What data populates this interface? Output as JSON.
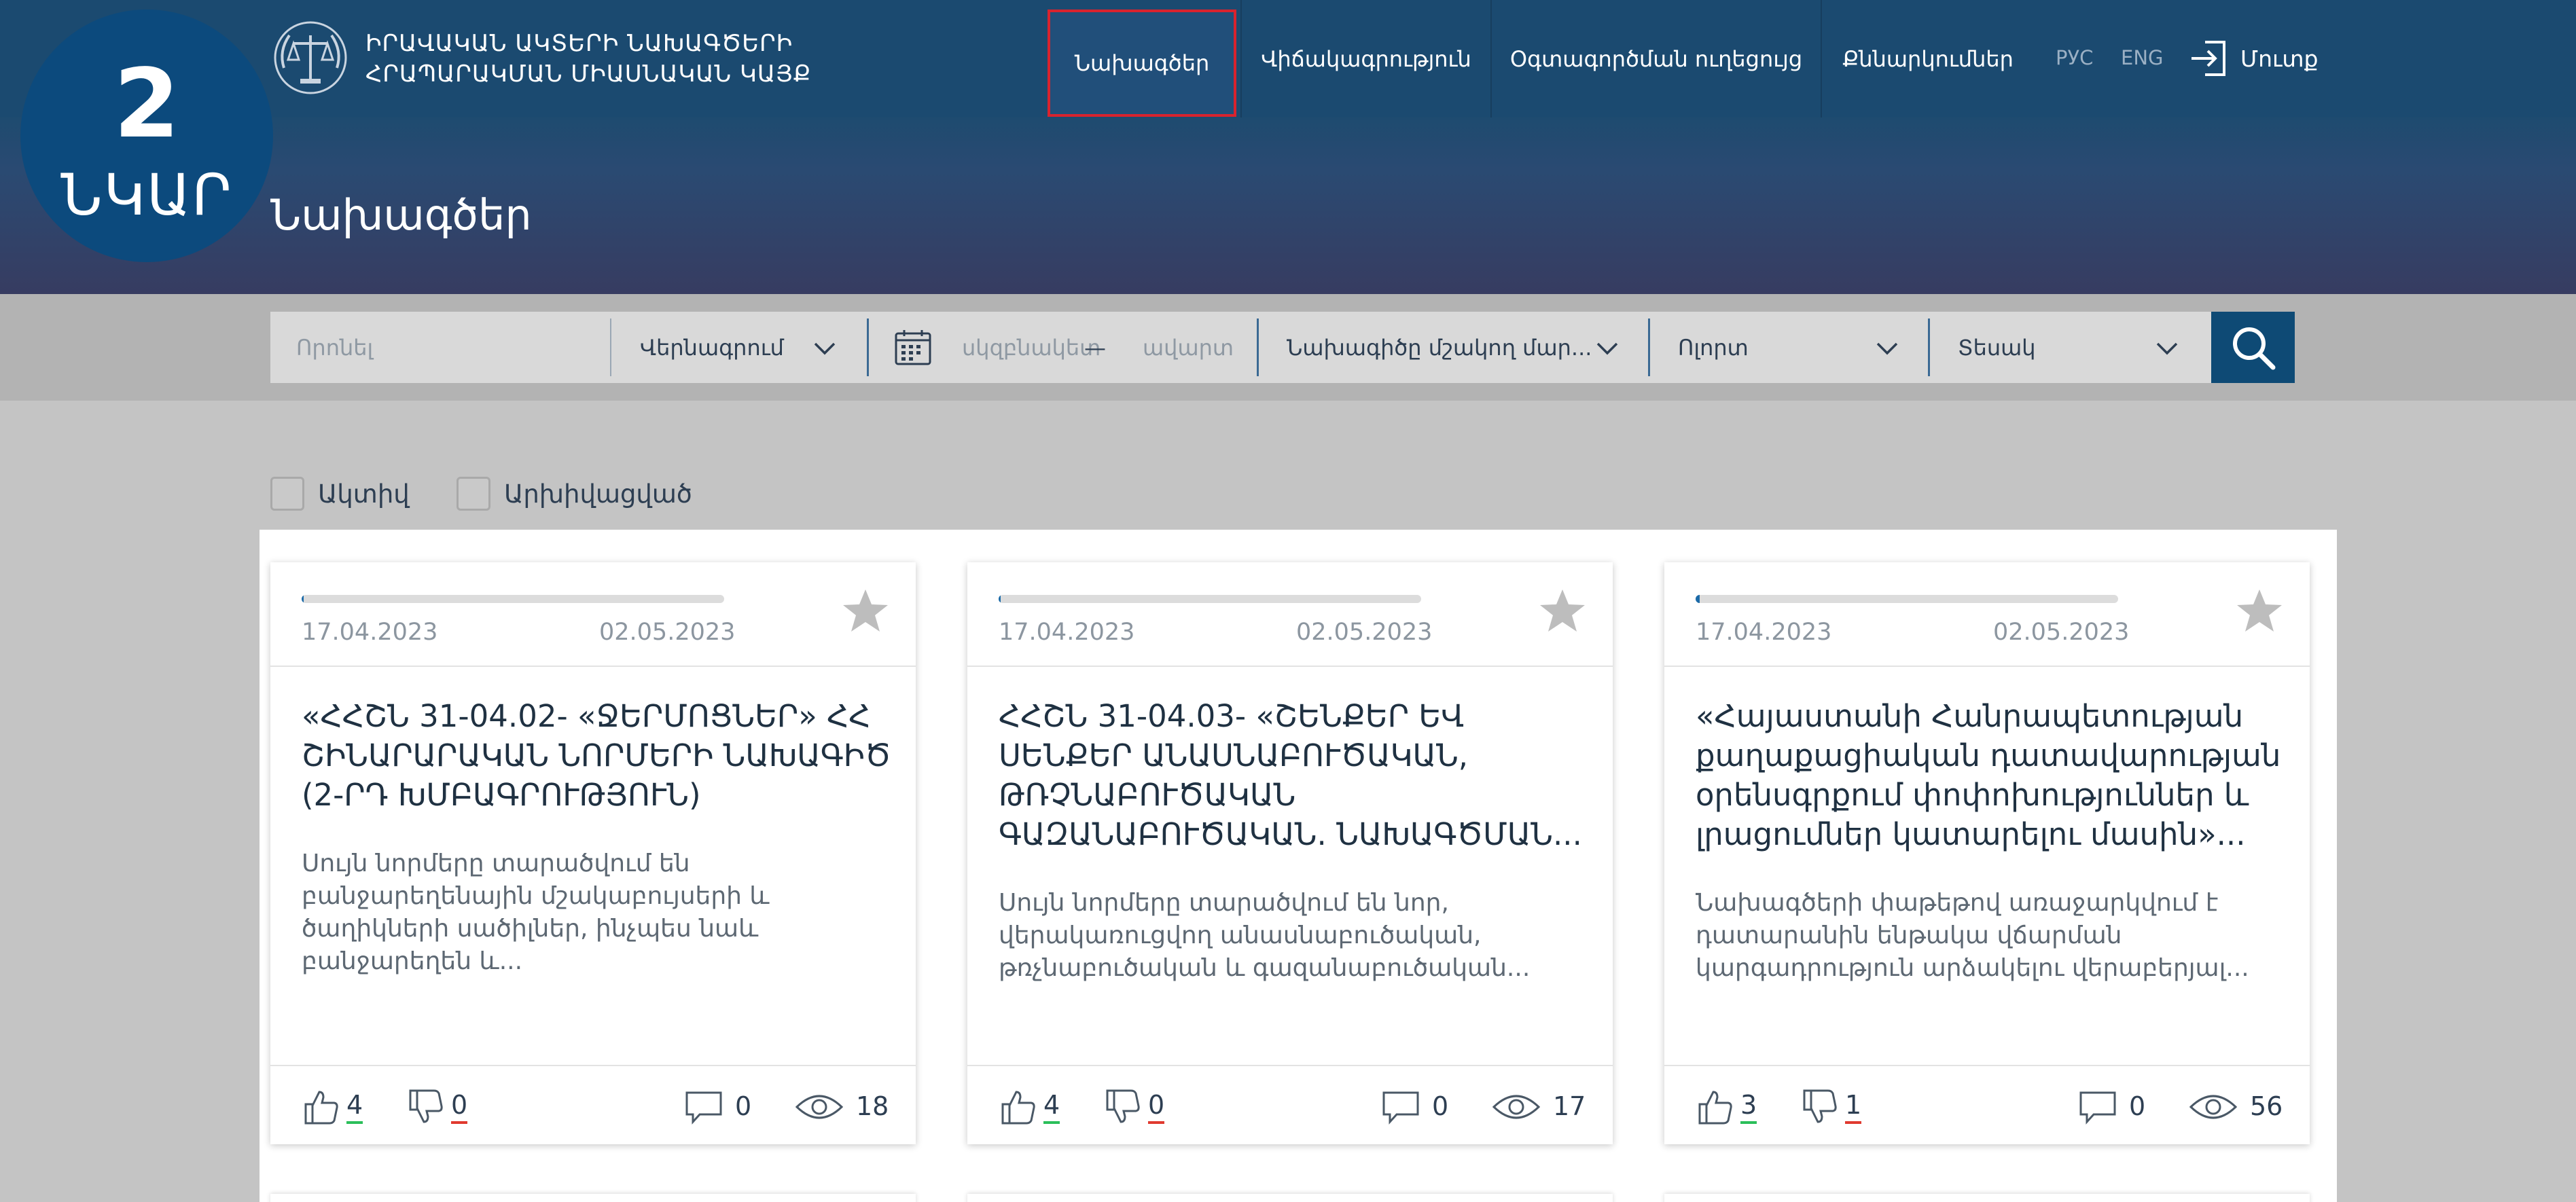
{
  "header": {
    "logo_line1": "ԻՐԱՎԱԿԱՆ ԱԿՏԵՐԻ ՆԱԽԱԳԾԵՐԻ",
    "logo_line2": "ՀՐԱՊԱՐԱԿՄԱՆ ՄԻԱՍՆԱԿԱՆ ԿԱՅՔ",
    "nav": [
      {
        "label": "Նախագծեր",
        "active": true
      },
      {
        "label": "Վիճակագրություն"
      },
      {
        "label": "Օգտագործման ուղեցույց"
      },
      {
        "label": "Քննարկումներ"
      }
    ],
    "lang_ru": "РУС",
    "lang_en": "ENG",
    "login_label": "Մուտք"
  },
  "badge": {
    "number": "2",
    "word": "ՆԿԱՐ"
  },
  "page_title": "Նախագծեր",
  "filters": {
    "search_placeholder": "Որոնել",
    "sort_label": "Վերնագրում",
    "date_from_placeholder": "սկզբնակետ",
    "date_to_placeholder": "ավարտ",
    "date_separator": "—",
    "developer_label": "Նախագիծը մշակող մար...",
    "area_label": "Ոլորտ",
    "type_label": "Տեսակ"
  },
  "checkboxes": {
    "active_label": "Ակտիվ",
    "archived_label": "Արխիվացված"
  },
  "cards": [
    {
      "start": "17.04.2023",
      "end": "02.05.2023",
      "progress": 0.0,
      "title": "«ՀՀՇՆ 31-04.02- «ՋԵՐՄՈՑՆԵՐ» ՀՀ ՇԻՆԱՐԱՐԱԿԱՆ ՆՈՐՄԵՐԻ ՆԱԽԱԳԻԾ (2-ՐԴ ԽՄԲԱԳՐՈՒԹՅՈՒՆ)",
      "description": "Սույն նորմերը տարածվում են բանջարեղենային մշակաբույսերի և ծաղիկների սածիլներ, ինչպես նաև բանջարեղեն և...",
      "likes": "4",
      "dislikes": "0",
      "comments": "0",
      "views": "18"
    },
    {
      "start": "17.04.2023",
      "end": "02.05.2023",
      "progress": 0.0,
      "title": "ՀՀՇՆ 31-04.03- «ՇԵՆՔԵՐ ԵՎ ՍԵՆՔԵՐ ԱՆԱՍՆԱԲՈՒԾԱԿԱՆ, ԹՌՉՆԱԲՈՒԾԱԿԱՆ ԳԱԶԱՆԱԲՈՒԾԱԿԱՆ. ՆԱԽԱԳԾՄԱՆ...",
      "description": "Սույն նորմերը տարածվում են նոր, վերակառուցվող անասնաբուծական, թռչնաբուծական և գազանաբուծական...",
      "likes": "4",
      "dislikes": "0",
      "comments": "0",
      "views": "17"
    },
    {
      "start": "17.04.2023",
      "end": "02.05.2023",
      "progress": 0.01,
      "title": "«Հայաստանի Հանրապետության քաղաքացիական դատավարության օրենսգրքում փոփոխություններ և լրացումներ կատարելու մասին»...",
      "description": "Նախագծերի փաթեթով առաջարկվում է դատարանին ենթակա վճարման կարգադրություն արձակելու վերաբերյալ...",
      "likes": "3",
      "dislikes": "1",
      "comments": "0",
      "views": "56"
    }
  ],
  "colors": {
    "header_bg": "#1b4a70",
    "accent_red": "#d9232e",
    "search_button": "#0e4a75",
    "like_underline": "#2bbf5a",
    "dislike_underline": "#e03a2f"
  },
  "icons": [
    "scales-emblem-icon",
    "login-icon",
    "calendar-icon",
    "chevron-down-icon",
    "search-icon",
    "star-icon",
    "thumbs-up-icon",
    "thumbs-down-icon",
    "comment-icon",
    "eye-icon"
  ]
}
